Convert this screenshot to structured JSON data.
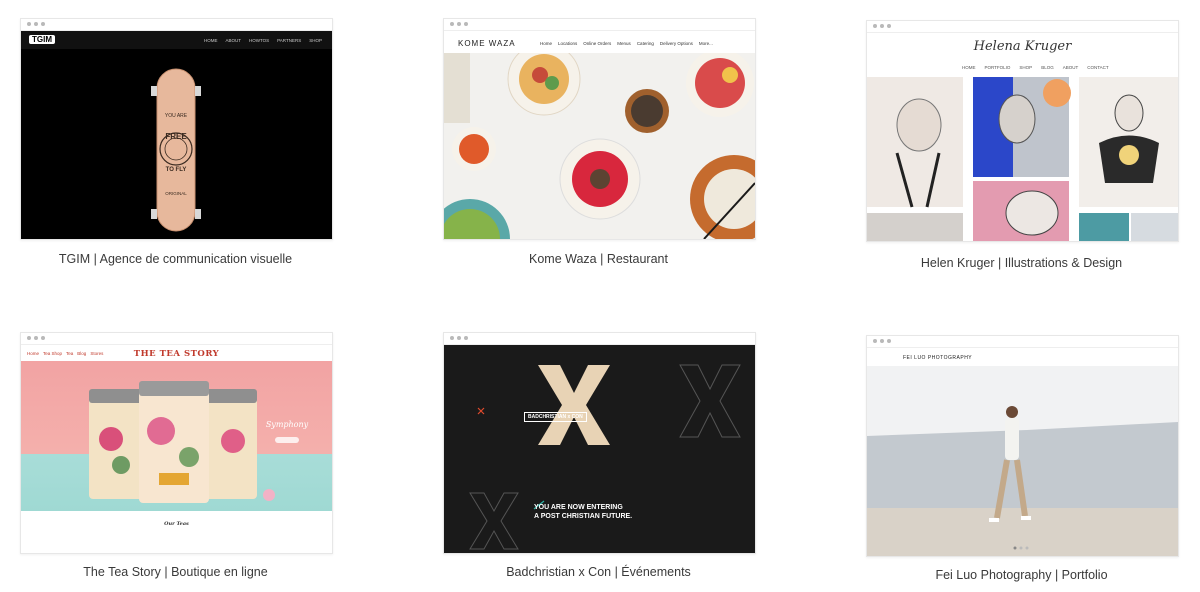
{
  "gallery": {
    "items": [
      {
        "caption": "TGIM | Agence de communication visuelle",
        "site_logo": "TGIM",
        "nav": [
          "HOME",
          "ABOUT",
          "HOWTOS",
          "PARTNERS",
          "SHOP"
        ],
        "board_text": [
          "YOU ARE",
          "FREE",
          "TO FLY",
          "ORIGINAL"
        ]
      },
      {
        "caption": "Kome Waza | Restaurant",
        "brand": "KOME WAZA",
        "nav": [
          "Home",
          "Locations",
          "Online Orders",
          "Menus",
          "Catering",
          "Delivery Options",
          "More..."
        ]
      },
      {
        "caption": "Helen Kruger | Illustrations & Design",
        "signature": "Helena Kruger",
        "nav": [
          "HOME",
          "PORTFOLIO",
          "SHOP",
          "BLOG",
          "ABOUT",
          "CONTACT"
        ]
      },
      {
        "caption": "The Tea Story | Boutique en ligne",
        "title": "THE TEA STORY",
        "nav": [
          "Home",
          "Tea Shop",
          "Tea",
          "Blog",
          "Stores"
        ],
        "hero_text": "Symphony",
        "section_title": "Our Teas"
      },
      {
        "caption": "Badchristian x Con | Événements",
        "tag": "BADCHRISTIAN x CON",
        "headline_1": "YOU ARE NOW ENTERING",
        "headline_2": "A POST CHRISTIAN FUTURE."
      },
      {
        "caption": "Fei Luo Photography | Portfolio",
        "brand": "FEI LUO PHOTOGRAPHY"
      }
    ]
  }
}
